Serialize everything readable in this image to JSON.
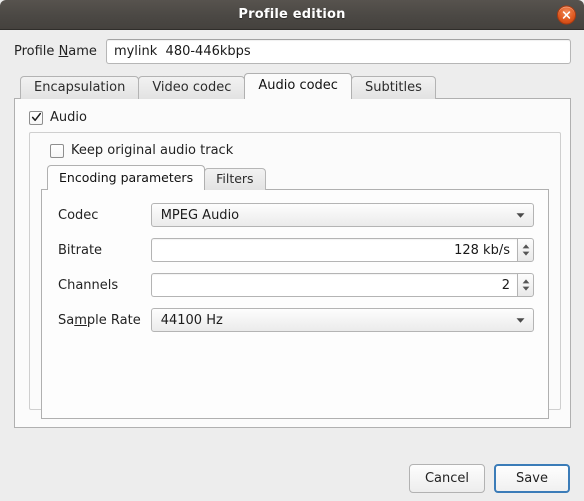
{
  "window": {
    "title": "Profile edition",
    "close_icon": "close-icon",
    "accent_color": "#e05a20",
    "titlebar_color": "#4b4844",
    "focus_color": "#3b7cb8"
  },
  "profile": {
    "label_prefix": "Profile ",
    "label_mnemonic": "N",
    "label_suffix": "ame",
    "name_value": "mylink  480-446kbps",
    "name_placeholder": "Profile name"
  },
  "tabs": [
    {
      "label": "Encapsulation",
      "active": false
    },
    {
      "label": "Video codec",
      "active": false
    },
    {
      "label": "Audio codec",
      "active": true
    },
    {
      "label": "Subtitles",
      "active": false
    }
  ],
  "audio_panel": {
    "audio_checkbox": {
      "label": "Audio",
      "checked": true
    },
    "keep_original_checkbox": {
      "label": "Keep original audio track",
      "checked": false
    },
    "inner_tabs": [
      {
        "label": "Encoding parameters",
        "active": true
      },
      {
        "label": "Filters",
        "active": false
      }
    ],
    "fields": {
      "codec": {
        "label": "Codec",
        "value": "MPEG Audio",
        "type": "dropdown",
        "icon": "chevron-down-icon"
      },
      "bitrate": {
        "label": "Bitrate",
        "value": "128 kb/s",
        "type": "spinner",
        "icon": "spinner-arrows-icon"
      },
      "channels": {
        "label": "Channels",
        "value": "2",
        "type": "spinner",
        "icon": "spinner-arrows-icon"
      },
      "sample_rate": {
        "label_prefix": "Sa",
        "label_mnemonic": "m",
        "label_suffix": "ple Rate",
        "label": "Sample Rate",
        "value": "44100 Hz",
        "type": "dropdown",
        "icon": "chevron-down-icon"
      }
    }
  },
  "footer": {
    "cancel_label": "Cancel",
    "save_label": "Save"
  }
}
